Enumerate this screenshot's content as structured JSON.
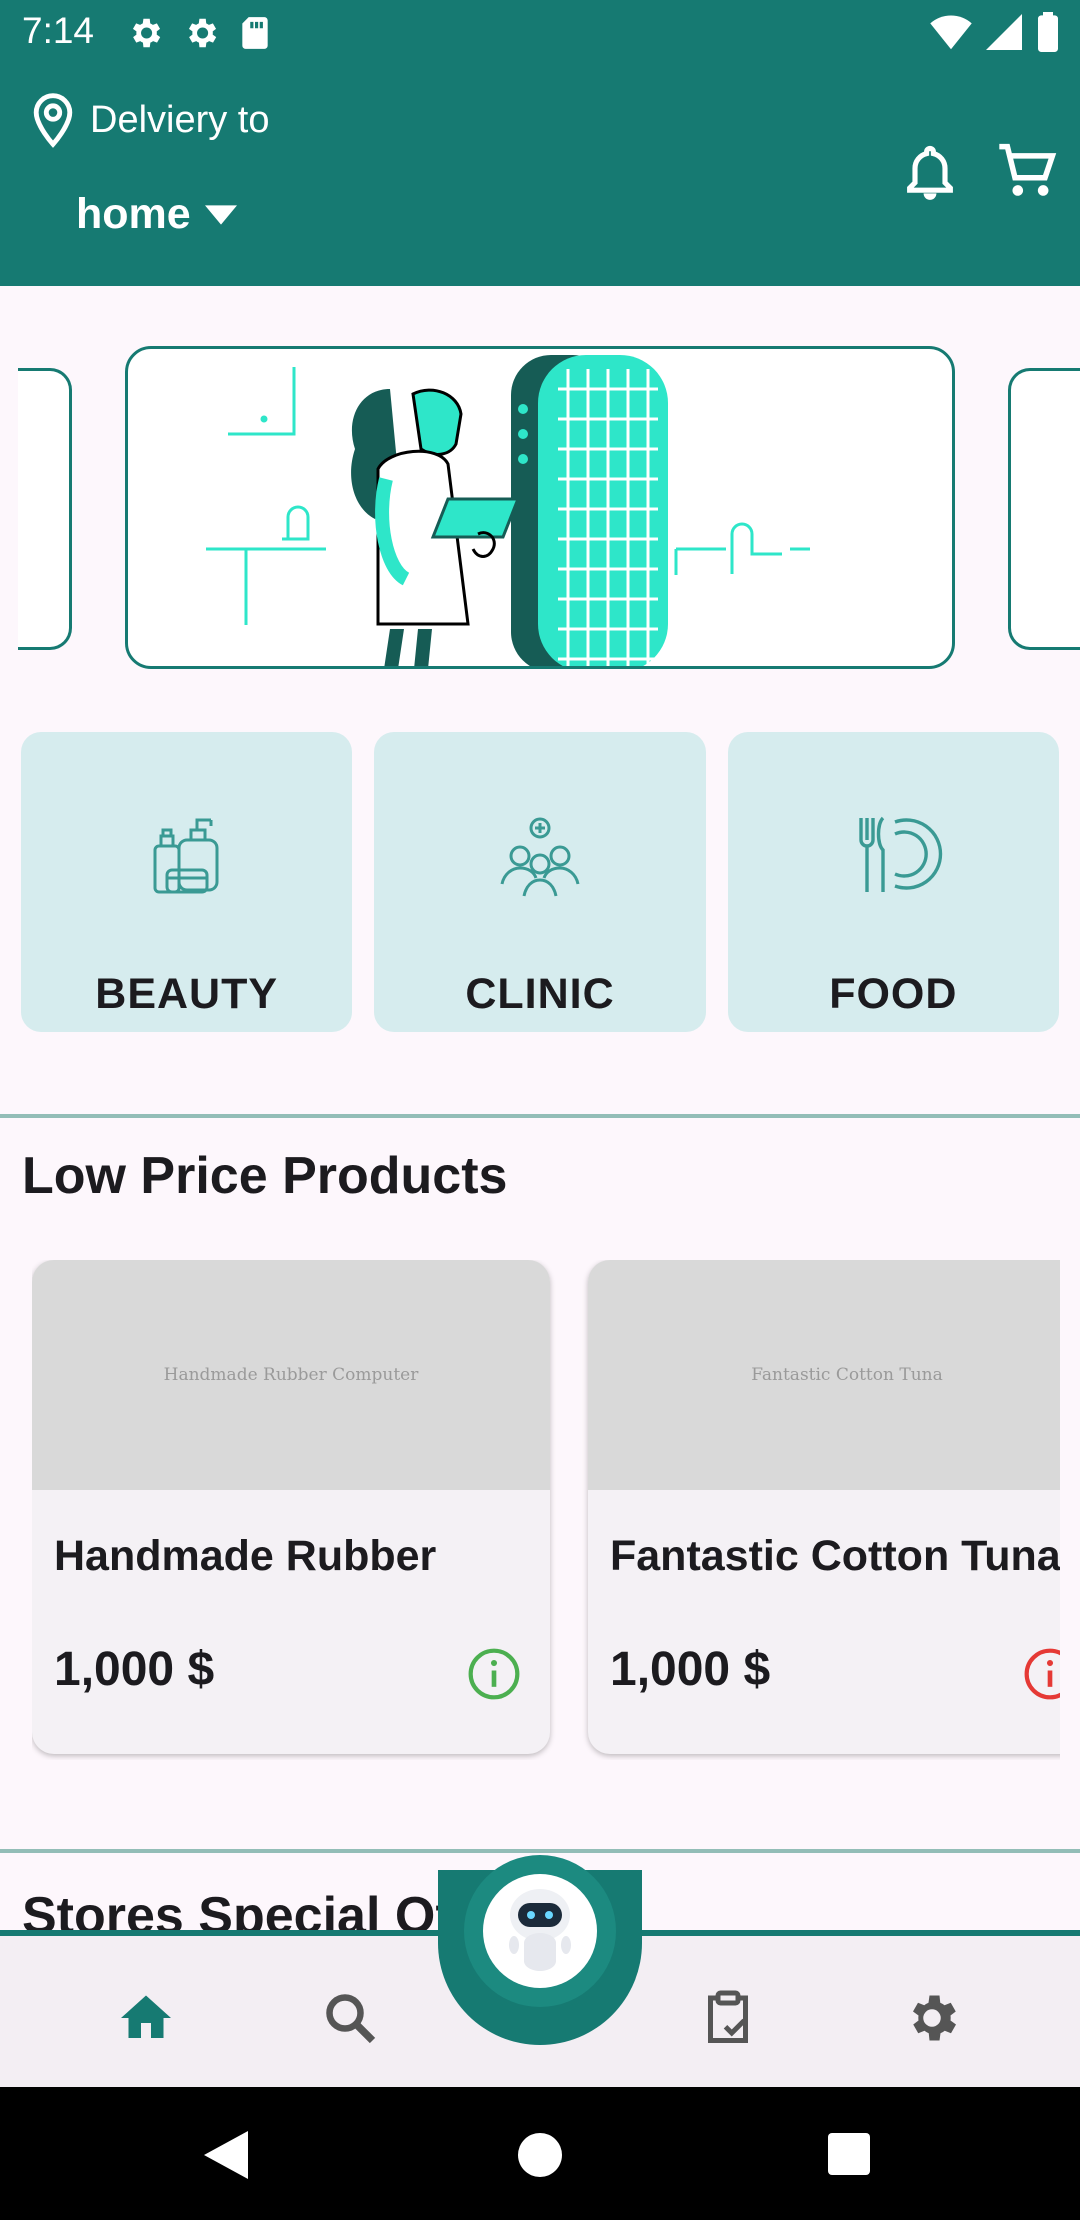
{
  "status_bar": {
    "time": "7:14",
    "left_icons": [
      "gear-icon",
      "gear-icon",
      "sd-card-icon"
    ],
    "right_icons": [
      "wifi-icon",
      "signal-icon",
      "battery-icon"
    ]
  },
  "header": {
    "delivery_label": "Delviery to",
    "location_value": "home",
    "background_color": "#167a72"
  },
  "categories": [
    {
      "label": "BEAUTY",
      "icon": "beauty-products-icon"
    },
    {
      "label": "CLINIC",
      "icon": "clinic-people-icon"
    },
    {
      "label": "FOOD",
      "icon": "plate-cutlery-icon"
    }
  ],
  "sections": {
    "low_price_title": "Low Price Products",
    "stores_offers_title": "Stores Special Offers"
  },
  "products": [
    {
      "image_text": "Handmade Rubber Computer",
      "name": "Handmade Rubber",
      "price": "1,000 $",
      "info_color": "#4caf50"
    },
    {
      "image_text": "Fantastic Cotton Tuna",
      "name": "Fantastic Cotton Tuna",
      "price": "1,000 $",
      "info_color": "#e53935"
    }
  ],
  "bottom_nav": {
    "items": [
      "home-icon",
      "search-icon",
      "robot-assistant-icon",
      "orders-clipboard-icon",
      "settings-icon"
    ],
    "active": "home-icon"
  },
  "system_nav": [
    "back-icon",
    "home-circle-icon",
    "recents-square-icon"
  ]
}
